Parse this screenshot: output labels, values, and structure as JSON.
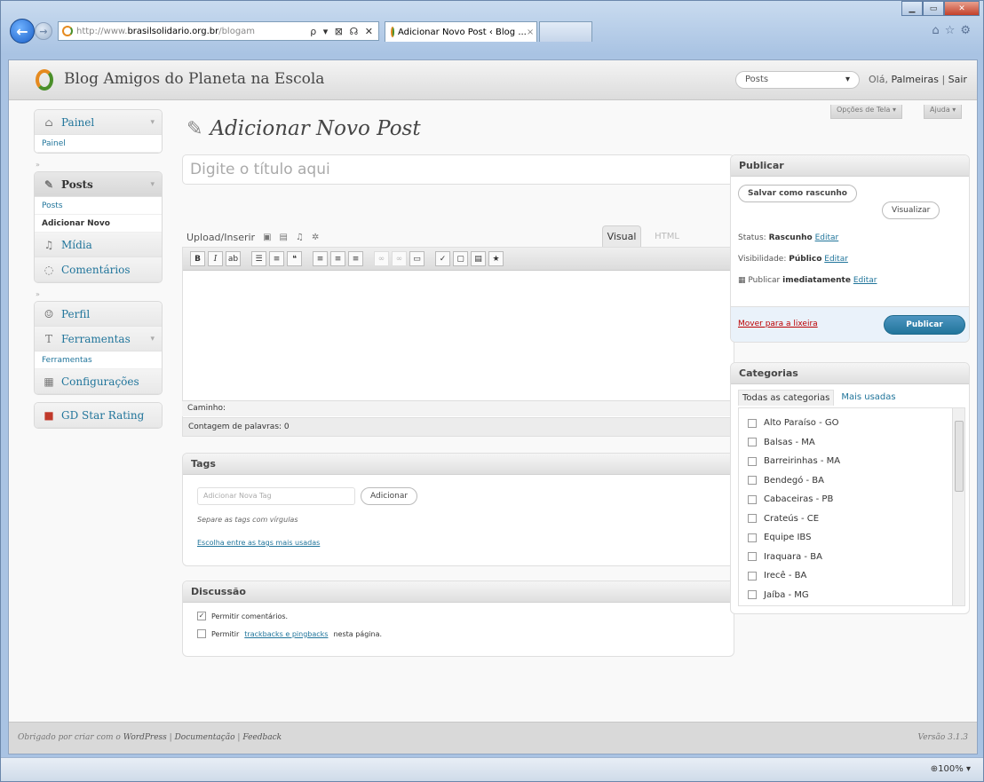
{
  "browser": {
    "url_prefix": "http://www.",
    "url_domain": "brasilsolidario.org.br",
    "url_suffix": "/blogam",
    "url_controls": "ρ ▾ ⊠ ☊ ✕",
    "tab_title": "Adicionar Novo Post ‹ Blog ...",
    "tab_close": "×",
    "zoom": "100%"
  },
  "header": {
    "site_title": "Blog Amigos do Planeta na Escola",
    "favorites_select": "Posts",
    "greeting_prefix": "Olá,",
    "user_name": "Palmeiras",
    "separator": "|",
    "logout": "Sair",
    "screen_options": "Opções de Tela",
    "help": "Ajuda"
  },
  "menu": {
    "painel": "Painel",
    "painel_sub": "Painel",
    "posts": "Posts",
    "posts_sub": [
      "Posts",
      "Adicionar Novo"
    ],
    "midia": "Mídia",
    "comentarios": "Comentários",
    "perfil": "Perfil",
    "ferramentas": "Ferramentas",
    "ferramentas_sub": "Ferramentas",
    "configuracoes": "Configurações",
    "gd_star": "GD Star Rating"
  },
  "editor": {
    "page_title": "Adicionar Novo Post",
    "title_placeholder": "Digite o título aqui",
    "upload_label": "Upload/Inserir",
    "tab_visual": "Visual",
    "tab_html": "HTML",
    "path_label": "Caminho:",
    "word_count": "Contagem de palavras: 0"
  },
  "tags": {
    "heading": "Tags",
    "input_placeholder": "Adicionar Nova Tag",
    "add_button": "Adicionar",
    "help": "Separe as tags com vírgulas",
    "cloud_link": "Escolha entre as tags mais usadas"
  },
  "discussion": {
    "heading": "Discussão",
    "allow_comments": "Permitir comentários.",
    "allow_trackbacks_prefix": "Permitir",
    "allow_trackbacks_link": "trackbacks e pingbacks",
    "allow_trackbacks_suffix": "nesta página."
  },
  "publish": {
    "heading": "Publicar",
    "save_draft": "Salvar como rascunho",
    "preview": "Visualizar",
    "status_label": "Status:",
    "status_value": "Rascunho",
    "visibility_label": "Visibilidade:",
    "visibility_value": "Público",
    "publish_label": "Publicar",
    "publish_value": "imediatamente",
    "edit": "Editar",
    "trash": "Mover para a lixeira",
    "publish_button": "Publicar"
  },
  "categories": {
    "heading": "Categorias",
    "tab_all": "Todas as categorias",
    "tab_popular": "Mais usadas",
    "items": [
      "Alto Paraíso - GO",
      "Balsas - MA",
      "Barreirinhas - MA",
      "Bendegó - BA",
      "Cabaceiras - PB",
      "Crateús - CE",
      "Equipe IBS",
      "Iraquara - BA",
      "Irecê - BA",
      "Jaíba - MG"
    ]
  },
  "footer": {
    "thanks_prefix": "Obrigado por criar com o",
    "wordpress": "WordPress",
    "sep": "|",
    "docs": "Documentação",
    "feedback": "Feedback",
    "version": "Versão 3.1.3"
  }
}
